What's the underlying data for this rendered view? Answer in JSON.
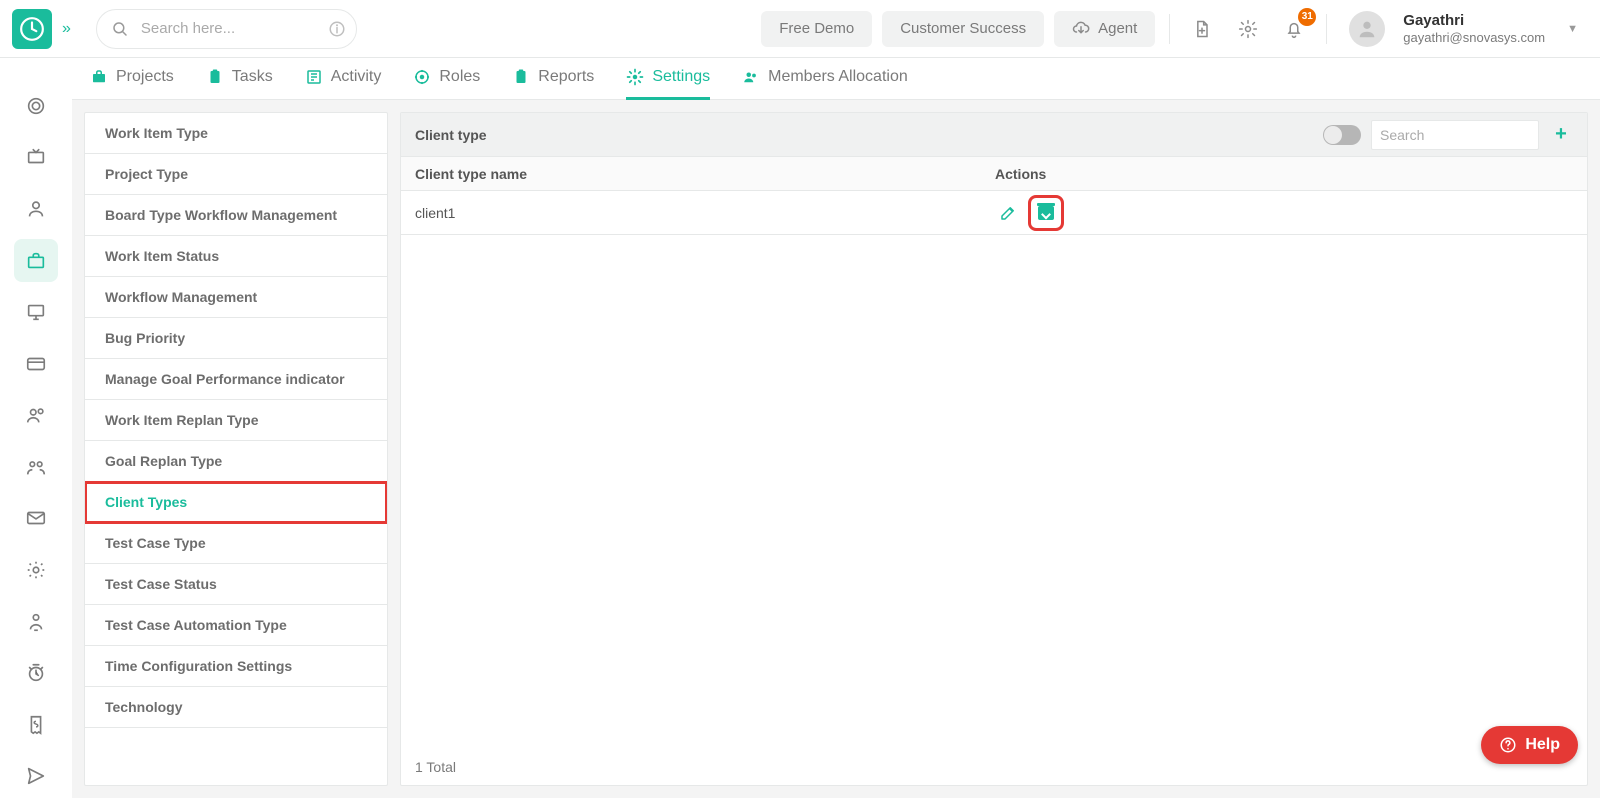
{
  "header": {
    "search_placeholder": "Search here...",
    "pills": {
      "free_demo": "Free Demo",
      "customer_success": "Customer Success",
      "agent": "Agent"
    },
    "notification_count": "31",
    "user": {
      "name": "Gayathri",
      "email": "gayathri@snovasys.com"
    }
  },
  "tabs": [
    {
      "key": "projects",
      "label": "Projects"
    },
    {
      "key": "tasks",
      "label": "Tasks"
    },
    {
      "key": "activity",
      "label": "Activity"
    },
    {
      "key": "roles",
      "label": "Roles"
    },
    {
      "key": "reports",
      "label": "Reports"
    },
    {
      "key": "settings",
      "label": "Settings",
      "active": true
    },
    {
      "key": "members",
      "label": "Members Allocation"
    }
  ],
  "settings_menu": [
    "Work Item Type",
    "Project Type",
    "Board Type Workflow Management",
    "Work Item Status",
    "Workflow Management",
    "Bug Priority",
    "Manage Goal Performance indicator",
    "Work Item Replan Type",
    "Goal Replan Type",
    "Client Types",
    "Test Case Type",
    "Test Case Status",
    "Test Case Automation Type",
    "Time Configuration Settings",
    "Technology"
  ],
  "settings_active_index": 9,
  "panel": {
    "title": "Client type",
    "search_placeholder": "Search",
    "columns": {
      "name": "Client type name",
      "actions": "Actions"
    },
    "rows": [
      {
        "name": "client1"
      }
    ],
    "footer": "1 Total"
  },
  "help_label": "Help"
}
